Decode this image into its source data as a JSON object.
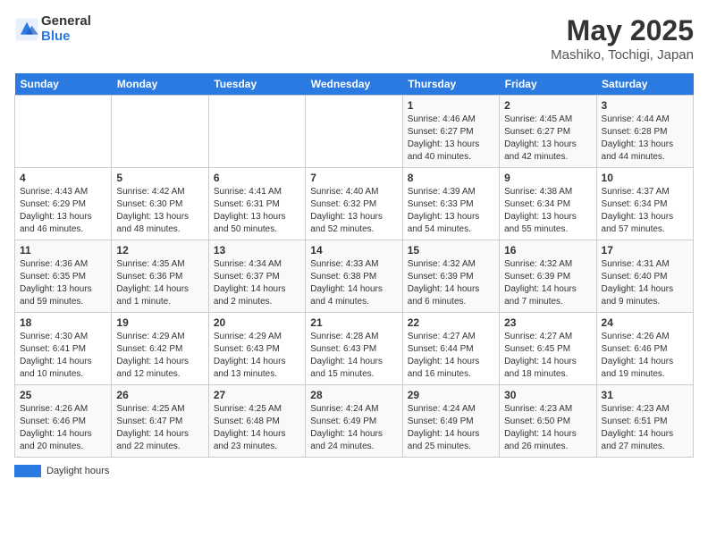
{
  "header": {
    "logo_line1": "General",
    "logo_line2": "Blue",
    "title": "May 2025",
    "subtitle": "Mashiko, Tochigi, Japan"
  },
  "days_of_week": [
    "Sunday",
    "Monday",
    "Tuesday",
    "Wednesday",
    "Thursday",
    "Friday",
    "Saturday"
  ],
  "legend_label": "Daylight hours",
  "weeks": [
    [
      {
        "day": "",
        "info": ""
      },
      {
        "day": "",
        "info": ""
      },
      {
        "day": "",
        "info": ""
      },
      {
        "day": "",
        "info": ""
      },
      {
        "day": "1",
        "info": "Sunrise: 4:46 AM\nSunset: 6:27 PM\nDaylight: 13 hours\nand 40 minutes."
      },
      {
        "day": "2",
        "info": "Sunrise: 4:45 AM\nSunset: 6:27 PM\nDaylight: 13 hours\nand 42 minutes."
      },
      {
        "day": "3",
        "info": "Sunrise: 4:44 AM\nSunset: 6:28 PM\nDaylight: 13 hours\nand 44 minutes."
      }
    ],
    [
      {
        "day": "4",
        "info": "Sunrise: 4:43 AM\nSunset: 6:29 PM\nDaylight: 13 hours\nand 46 minutes."
      },
      {
        "day": "5",
        "info": "Sunrise: 4:42 AM\nSunset: 6:30 PM\nDaylight: 13 hours\nand 48 minutes."
      },
      {
        "day": "6",
        "info": "Sunrise: 4:41 AM\nSunset: 6:31 PM\nDaylight: 13 hours\nand 50 minutes."
      },
      {
        "day": "7",
        "info": "Sunrise: 4:40 AM\nSunset: 6:32 PM\nDaylight: 13 hours\nand 52 minutes."
      },
      {
        "day": "8",
        "info": "Sunrise: 4:39 AM\nSunset: 6:33 PM\nDaylight: 13 hours\nand 54 minutes."
      },
      {
        "day": "9",
        "info": "Sunrise: 4:38 AM\nSunset: 6:34 PM\nDaylight: 13 hours\nand 55 minutes."
      },
      {
        "day": "10",
        "info": "Sunrise: 4:37 AM\nSunset: 6:34 PM\nDaylight: 13 hours\nand 57 minutes."
      }
    ],
    [
      {
        "day": "11",
        "info": "Sunrise: 4:36 AM\nSunset: 6:35 PM\nDaylight: 13 hours\nand 59 minutes."
      },
      {
        "day": "12",
        "info": "Sunrise: 4:35 AM\nSunset: 6:36 PM\nDaylight: 14 hours\nand 1 minute."
      },
      {
        "day": "13",
        "info": "Sunrise: 4:34 AM\nSunset: 6:37 PM\nDaylight: 14 hours\nand 2 minutes."
      },
      {
        "day": "14",
        "info": "Sunrise: 4:33 AM\nSunset: 6:38 PM\nDaylight: 14 hours\nand 4 minutes."
      },
      {
        "day": "15",
        "info": "Sunrise: 4:32 AM\nSunset: 6:39 PM\nDaylight: 14 hours\nand 6 minutes."
      },
      {
        "day": "16",
        "info": "Sunrise: 4:32 AM\nSunset: 6:39 PM\nDaylight: 14 hours\nand 7 minutes."
      },
      {
        "day": "17",
        "info": "Sunrise: 4:31 AM\nSunset: 6:40 PM\nDaylight: 14 hours\nand 9 minutes."
      }
    ],
    [
      {
        "day": "18",
        "info": "Sunrise: 4:30 AM\nSunset: 6:41 PM\nDaylight: 14 hours\nand 10 minutes."
      },
      {
        "day": "19",
        "info": "Sunrise: 4:29 AM\nSunset: 6:42 PM\nDaylight: 14 hours\nand 12 minutes."
      },
      {
        "day": "20",
        "info": "Sunrise: 4:29 AM\nSunset: 6:43 PM\nDaylight: 14 hours\nand 13 minutes."
      },
      {
        "day": "21",
        "info": "Sunrise: 4:28 AM\nSunset: 6:43 PM\nDaylight: 14 hours\nand 15 minutes."
      },
      {
        "day": "22",
        "info": "Sunrise: 4:27 AM\nSunset: 6:44 PM\nDaylight: 14 hours\nand 16 minutes."
      },
      {
        "day": "23",
        "info": "Sunrise: 4:27 AM\nSunset: 6:45 PM\nDaylight: 14 hours\nand 18 minutes."
      },
      {
        "day": "24",
        "info": "Sunrise: 4:26 AM\nSunset: 6:46 PM\nDaylight: 14 hours\nand 19 minutes."
      }
    ],
    [
      {
        "day": "25",
        "info": "Sunrise: 4:26 AM\nSunset: 6:46 PM\nDaylight: 14 hours\nand 20 minutes."
      },
      {
        "day": "26",
        "info": "Sunrise: 4:25 AM\nSunset: 6:47 PM\nDaylight: 14 hours\nand 22 minutes."
      },
      {
        "day": "27",
        "info": "Sunrise: 4:25 AM\nSunset: 6:48 PM\nDaylight: 14 hours\nand 23 minutes."
      },
      {
        "day": "28",
        "info": "Sunrise: 4:24 AM\nSunset: 6:49 PM\nDaylight: 14 hours\nand 24 minutes."
      },
      {
        "day": "29",
        "info": "Sunrise: 4:24 AM\nSunset: 6:49 PM\nDaylight: 14 hours\nand 25 minutes."
      },
      {
        "day": "30",
        "info": "Sunrise: 4:23 AM\nSunset: 6:50 PM\nDaylight: 14 hours\nand 26 minutes."
      },
      {
        "day": "31",
        "info": "Sunrise: 4:23 AM\nSunset: 6:51 PM\nDaylight: 14 hours\nand 27 minutes."
      }
    ]
  ]
}
